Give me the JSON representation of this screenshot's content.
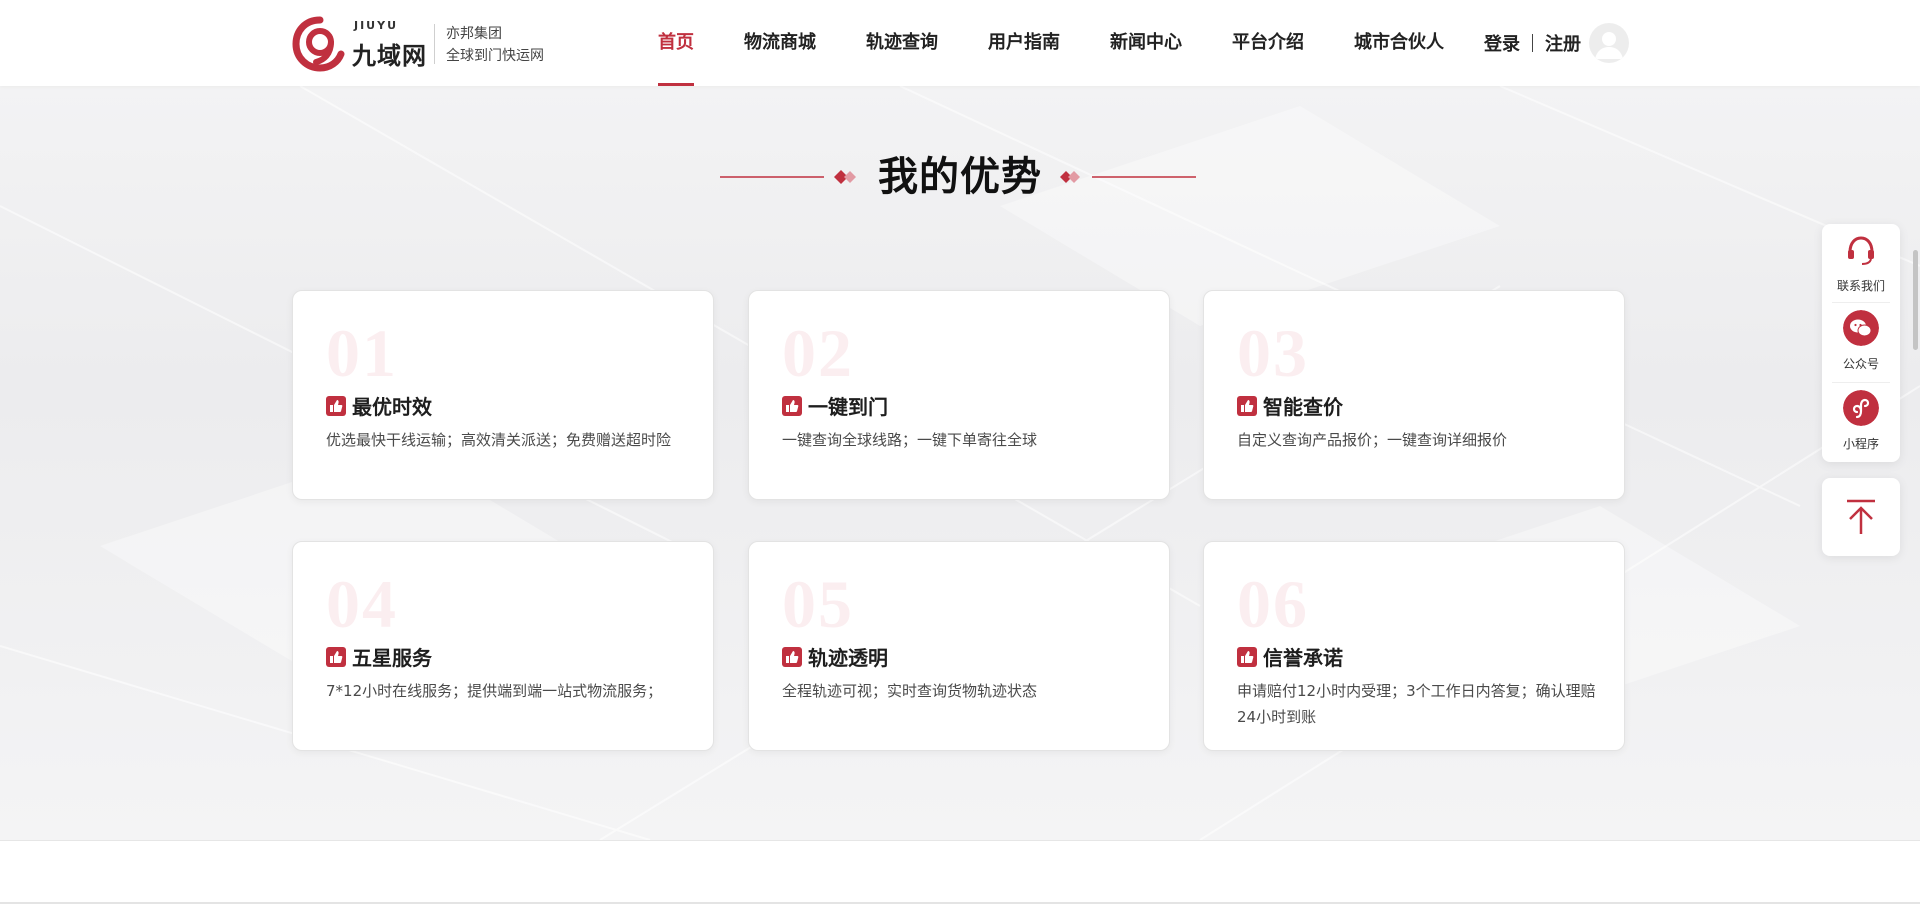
{
  "header": {
    "brand_en": "JIUYU",
    "brand_cn": "九域网",
    "brand_group": "亦邦集团",
    "brand_slogan": "全球到门快运网",
    "nav": [
      {
        "label": "首页",
        "active": true
      },
      {
        "label": "物流商城"
      },
      {
        "label": "轨迹查询"
      },
      {
        "label": "用户指南"
      },
      {
        "label": "新闻中心"
      },
      {
        "label": "平台介绍"
      },
      {
        "label": "城市合伙人"
      }
    ],
    "login_label": "登录",
    "register_label": "注册"
  },
  "section": {
    "title": "我的优势"
  },
  "cards": [
    {
      "num": "01",
      "title": "最优时效",
      "desc": "优选最快干线运输；高效清关派送；免费赠送超时险"
    },
    {
      "num": "02",
      "title": "一键到门",
      "desc": "一键查询全球线路；一键下单寄往全球"
    },
    {
      "num": "03",
      "title": "智能查价",
      "desc": "自定义查询产品报价；一键查询详细报价"
    },
    {
      "num": "04",
      "title": "五星服务",
      "desc": "7*12小时在线服务；提供端到端一站式物流服务；"
    },
    {
      "num": "05",
      "title": "轨迹透明",
      "desc": "全程轨迹可视；实时查询货物轨迹状态"
    },
    {
      "num": "06",
      "title": "信誉承诺",
      "desc": "申请赔付12小时内受理；3个工作日内答复；确认理赔24小时到账"
    }
  ],
  "float": {
    "contact_label": "联系我们",
    "wechat_label": "公众号",
    "miniprogram_label": "小程序"
  },
  "colors": {
    "accent": "#c0303f",
    "card_number": "#fbeef0"
  }
}
